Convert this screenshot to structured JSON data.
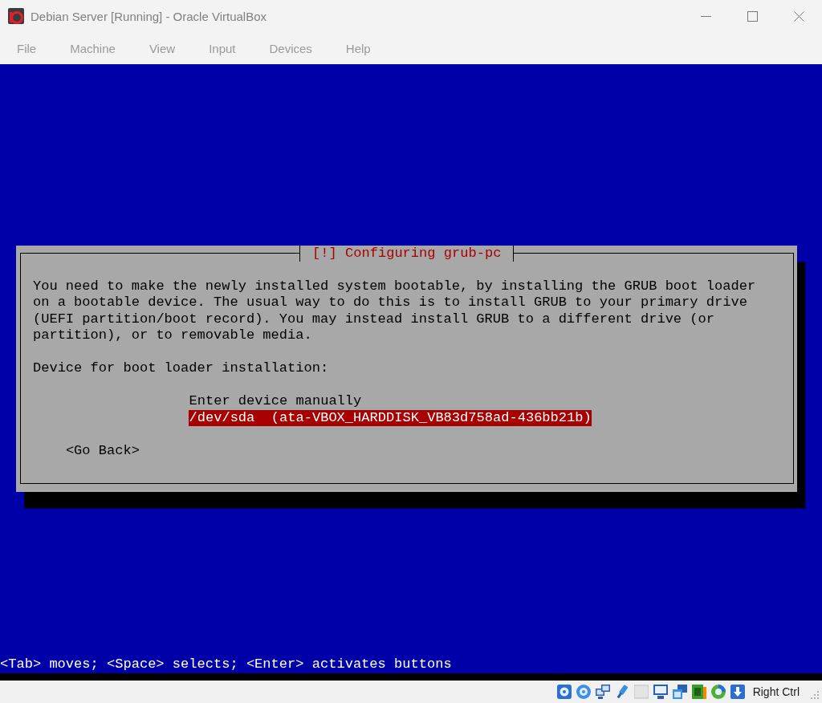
{
  "window": {
    "title": "Debian Server [Running] - Oracle VirtualBox"
  },
  "menu": [
    "File",
    "Machine",
    "View",
    "Input",
    "Devices",
    "Help"
  ],
  "dialog": {
    "title": "[!] Configuring grub-pc",
    "message": "You need to make the newly installed system bootable, by installing the GRUB boot loader on a bootable device. The usual way to do this is to install GRUB to your primary drive (UEFI partition/boot record). You may instead install GRUB to a different drive (or partition), or to removable media.",
    "prompt": "Device for boot loader installation:",
    "options": [
      {
        "label": "Enter device manually",
        "selected": false
      },
      {
        "label": "/dev/sda  (ata-VBOX_HARDDISK_VB83d758ad-436bb21b)",
        "selected": true
      }
    ],
    "buttons": [
      "<Go Back>"
    ]
  },
  "hint": "<Tab> moves; <Space> selects; <Enter> activates buttons",
  "status_bar": {
    "host_key": "Right Ctrl"
  }
}
